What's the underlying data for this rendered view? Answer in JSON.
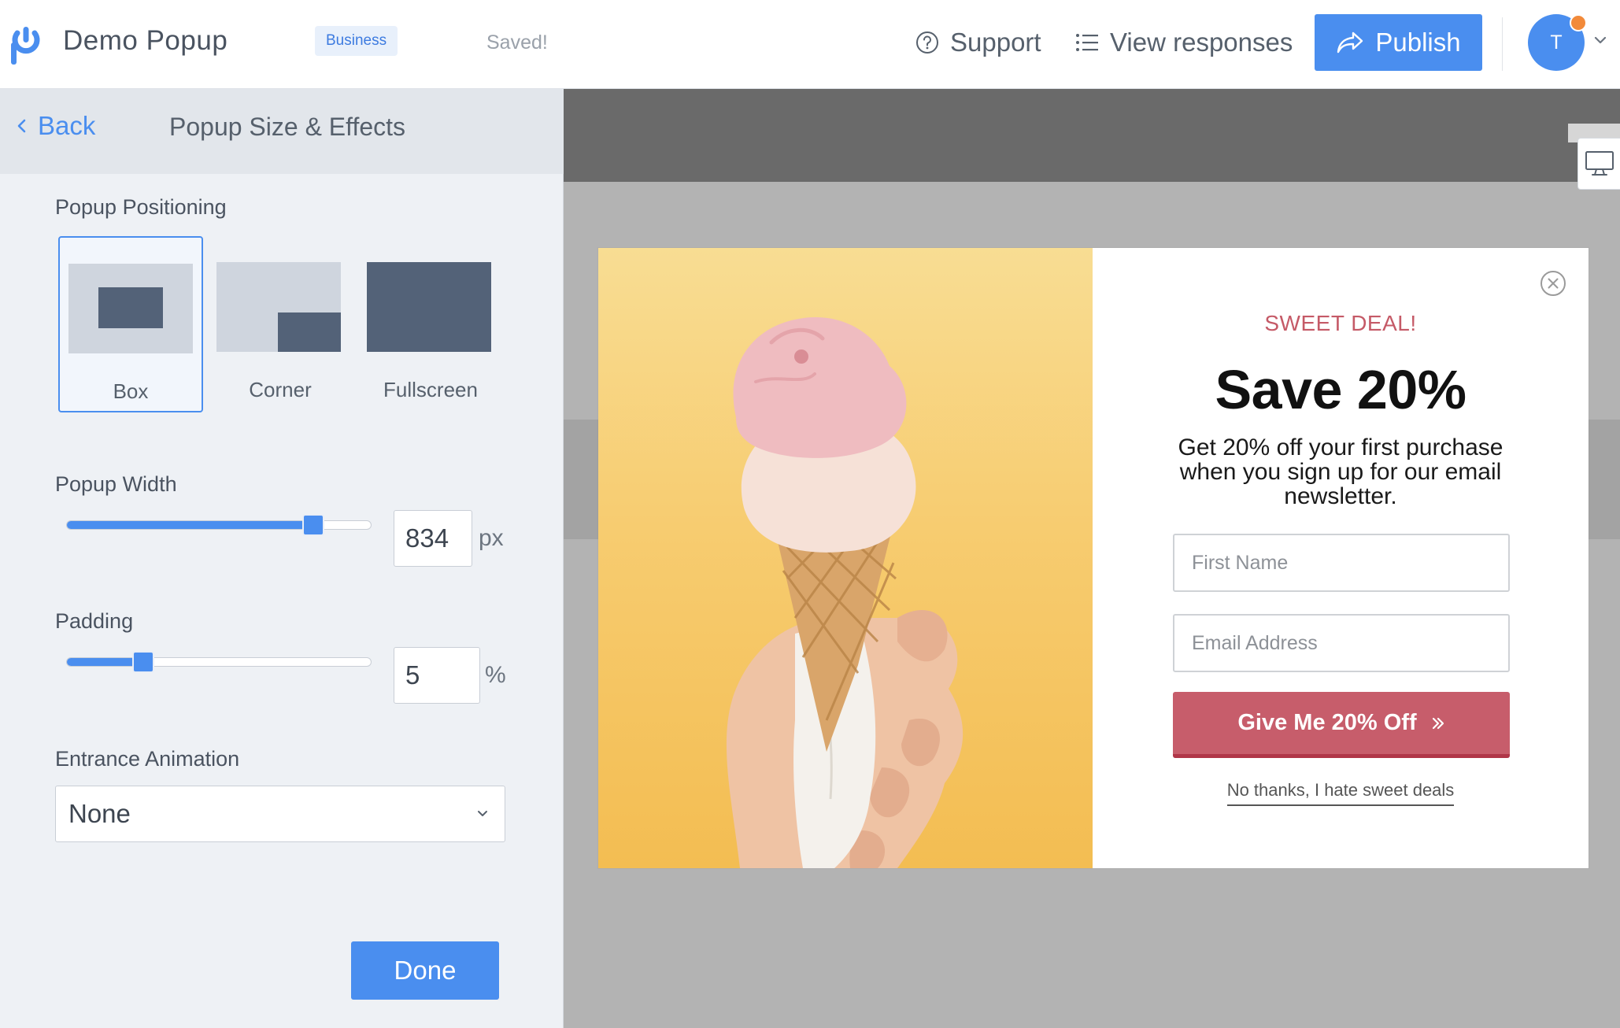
{
  "header": {
    "app_title": "Demo Popup",
    "plan_badge": "Business",
    "save_status": "Saved!",
    "support_label": "Support",
    "responses_label": "View responses",
    "publish_label": "Publish",
    "avatar_initial": "T",
    "brand_color": "#4a8eef",
    "notification_color": "#f28a3a"
  },
  "panel": {
    "back_label": "Back",
    "title": "Popup Size & Effects",
    "positioning": {
      "label": "Popup Positioning",
      "selected": "Box",
      "options": [
        {
          "label": "Box"
        },
        {
          "label": "Corner"
        },
        {
          "label": "Fullscreen"
        }
      ]
    },
    "width": {
      "label": "Popup Width",
      "value": "834",
      "unit": "px",
      "slider_fraction": 0.81
    },
    "padding": {
      "label": "Padding",
      "value": "5",
      "unit": "%",
      "slider_fraction": 0.25
    },
    "animation": {
      "label": "Entrance Animation",
      "value": "None"
    },
    "done_label": "Done"
  },
  "popup": {
    "eyebrow": "SWEET DEAL!",
    "heading": "Save 20%",
    "body": "Get 20% off your first purchase when you sign up for our email newsletter.",
    "first_name_placeholder": "First Name",
    "email_placeholder": "Email Address",
    "cta_label": "Give Me 20% Off",
    "decline_label": "No thanks, I hate sweet deals",
    "accent_color": "#c75d6b"
  }
}
